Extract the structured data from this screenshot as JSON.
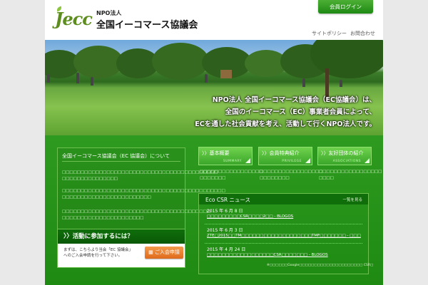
{
  "header": {
    "logo_mark": "Jecc",
    "logo_npo": "NPO法人",
    "logo_name": "全国イーコマース協議会",
    "login_label": "会員ログイン",
    "sitepolicy_label": "サイトポリシー",
    "contact_label": "お問合わせ"
  },
  "hero": {
    "lines": [
      "NPO法人 全国イーコマース協議会（EC協議会）は、",
      "全国のイーコマース（EC）事業者会員によって、",
      "ECを通した社会貢献を考え、活動して行くNPO法人です。"
    ]
  },
  "about": {
    "title": "全国イーコマース協議会（EC 協議会）について",
    "paragraphs": [
      "□□□□□□□□□□□□□□□□□□□□□□□□□□□□□□□□□□□□□□□□□□ □□□□□□□□□□□□□□□",
      "□□□□□□□□□□□□□□□□□□□□□□□□□□□□□□□□□□□□□□□□□□□□ □□□□□□□□□□□□□□□□□□□□□□□□",
      "□□□□□□□□□□□□□□□□□□□□□□□□□□□□□□□□□□□□□□□□ □□□□□□□□□□□□□□□□□□□□□□"
    ]
  },
  "join": {
    "heading": "〉〉活動に参加するには？",
    "desc_line1": "まずは、こちらより当会「EC 協議会」",
    "desc_line2": "へのご入会申請を行って下さい。",
    "button_label": "ご入会申請"
  },
  "tabs": [
    {
      "label": "〉〉基本概要",
      "sub": "SUMMARY",
      "desc": "□□□□□□□□□□□□□□□□□ □□□□□□□"
    },
    {
      "label": "〉〉会員特典紹介",
      "sub": "PRIVILEGE",
      "desc": "□□□□□□□□□□□□□□□□□ □□□□□□□□"
    },
    {
      "label": "〉〉友好団体の紹介",
      "sub": "ASSOCIATIONS",
      "desc": "□□□□□□□□□□□□□□□□□ □□□□"
    }
  ],
  "news": {
    "title": "Eco CSR ニュース",
    "more_label": "一覧を見る",
    "items": [
      {
        "date": "2015 年 6 月 8 日",
        "title": "□□□□□□□□□CSR□□□□2□□ - BLOGOS"
      },
      {
        "date": "2015 年 6 月 3 日",
        "title": "ZTE□2015□□TM□□□□□□□□□□□□□□□□□□□TMF□□□□□□□ - □□□"
      },
      {
        "date": "2015 年 4 月 24 日",
        "title": "□□□□□□□□□□□□□□□□□□CSR□□□□□□□ - BLOGOS"
      }
    ],
    "footnote": "※□□□□□□Google□□□□□□□□□□□□□□□□□□□□□ CSR□"
  }
}
